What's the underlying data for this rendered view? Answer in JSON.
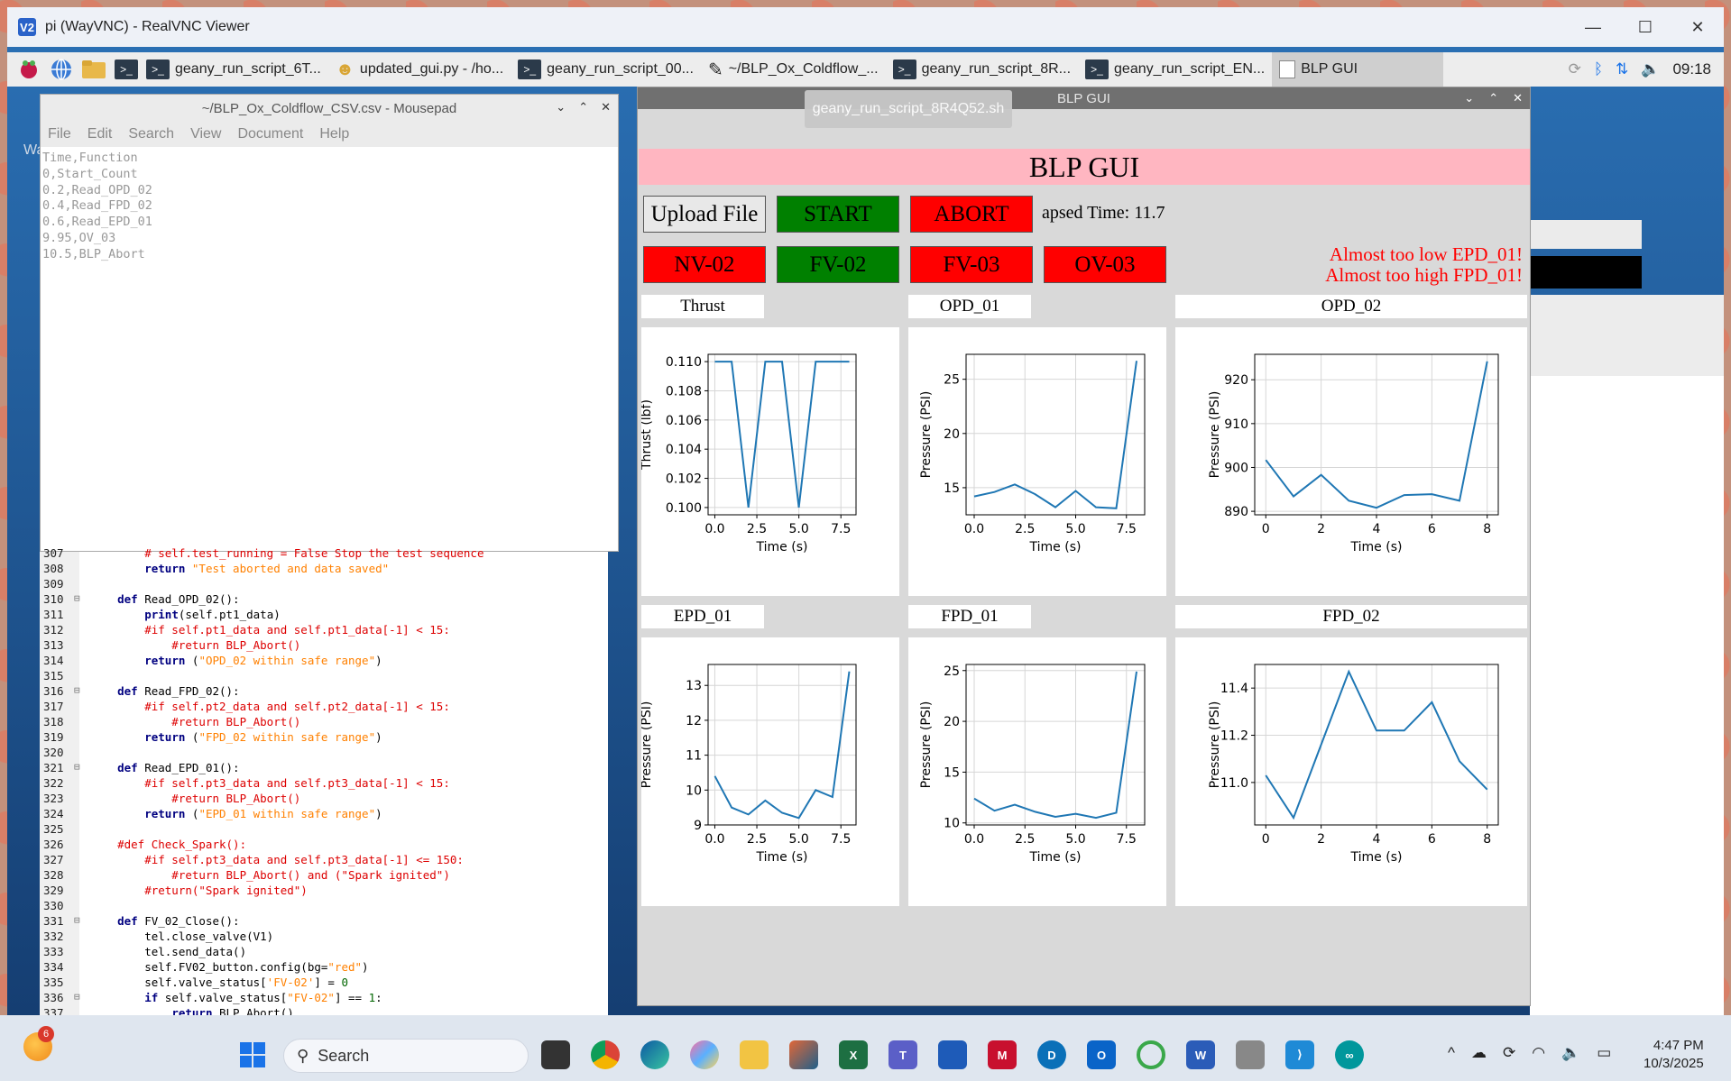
{
  "vnc": {
    "title": "pi (WayVNC) - RealVNC Viewer",
    "logo": "V2",
    "controls": [
      "—",
      "☐",
      "✕"
    ]
  },
  "pi_panel": {
    "tasks": [
      {
        "label": "geany_run_script_6T...",
        "icon": "terminal-icon"
      },
      {
        "label": "updated_gui.py - /ho...",
        "icon": "geany-icon"
      },
      {
        "label": "geany_run_script_00...",
        "icon": "terminal-icon"
      },
      {
        "label": "~/BLP_Ox_Coldflow_...",
        "icon": "mousepad-icon"
      },
      {
        "label": "geany_run_script_8R...",
        "icon": "terminal-icon"
      },
      {
        "label": "geany_run_script_EN...",
        "icon": "terminal-icon"
      },
      {
        "label": "BLP GUI",
        "icon": "window-icon"
      }
    ],
    "time": "09:18"
  },
  "tooltip": "geany_run_script_8R4Q52.sh",
  "side_label": "Wa",
  "mousepad": {
    "title": "~/BLP_Ox_Coldflow_CSV.csv - Mousepad",
    "menu": [
      "File",
      "Edit",
      "Search",
      "View",
      "Document",
      "Help"
    ],
    "content": "Time,Function\n0,Start_Count\n0.2,Read_OPD_02\n0.4,Read_FPD_02\n0.6,Read_EPD_01\n9.95,OV_03\n10.5,BLP_Abort"
  },
  "editor": {
    "lines": [
      {
        "n": "307",
        "text": "        # self.test_running = False Stop the test sequence",
        "cls": "cmt"
      },
      {
        "n": "308",
        "text": "        return \"Test aborted and data saved\"",
        "cls": "mix_return_str"
      },
      {
        "n": "309",
        "text": "",
        "cls": ""
      },
      {
        "n": "310",
        "text": "    def Read_OPD_02():",
        "cls": "def",
        "fold": true
      },
      {
        "n": "311",
        "text": "        print(self.pt1_data)",
        "cls": "print"
      },
      {
        "n": "312",
        "text": "        #if self.pt1_data and self.pt1_data[-1] < 15:",
        "cls": "cmt"
      },
      {
        "n": "313",
        "text": "            #return BLP_Abort()",
        "cls": "cmt"
      },
      {
        "n": "314",
        "text": "        return (\"OPD_02 within safe range\")",
        "cls": "mix_return_str"
      },
      {
        "n": "315",
        "text": "",
        "cls": ""
      },
      {
        "n": "316",
        "text": "    def Read_FPD_02():",
        "cls": "def",
        "fold": true
      },
      {
        "n": "317",
        "text": "        #if self.pt2_data and self.pt2_data[-1] < 15:",
        "cls": "cmt"
      },
      {
        "n": "318",
        "text": "            #return BLP_Abort()",
        "cls": "cmt"
      },
      {
        "n": "319",
        "text": "        return (\"FPD_02 within safe range\")",
        "cls": "mix_return_str"
      },
      {
        "n": "320",
        "text": "",
        "cls": ""
      },
      {
        "n": "321",
        "text": "    def Read_EPD_01():",
        "cls": "def",
        "fold": true
      },
      {
        "n": "322",
        "text": "        #if self.pt3_data and self.pt3_data[-1] < 15:",
        "cls": "cmt"
      },
      {
        "n": "323",
        "text": "            #return BLP_Abort()",
        "cls": "cmt"
      },
      {
        "n": "324",
        "text": "        return (\"EPD_01 within safe range\")",
        "cls": "mix_return_str"
      },
      {
        "n": "325",
        "text": "",
        "cls": ""
      },
      {
        "n": "326",
        "text": "    #def Check_Spark():",
        "cls": "cmt"
      },
      {
        "n": "327",
        "text": "        #if self.pt3_data and self.pt3_data[-1] <= 150:",
        "cls": "cmt"
      },
      {
        "n": "328",
        "text": "            #return BLP_Abort() and (\"Spark ignited\")",
        "cls": "cmt"
      },
      {
        "n": "329",
        "text": "        #return(\"Spark ignited\")",
        "cls": "cmt"
      },
      {
        "n": "330",
        "text": "",
        "cls": ""
      },
      {
        "n": "331",
        "text": "    def FV_02_Close():",
        "cls": "def",
        "fold": true
      },
      {
        "n": "332",
        "text": "        tel.close_valve(V1)",
        "cls": "plain"
      },
      {
        "n": "333",
        "text": "        tel.send_data()",
        "cls": "plain"
      },
      {
        "n": "334",
        "text": "        self.FV02_button.config(bg=\"red\")",
        "cls": "plain"
      },
      {
        "n": "335",
        "text": "        self.valve_status['FV-02'] = 0",
        "cls": "plain"
      },
      {
        "n": "336",
        "text": "        if self.valve_status[\"FV-02\"] == 1:",
        "cls": "if",
        "fold": true
      },
      {
        "n": "337",
        "text": "            return BLP_Abort()",
        "cls": "mix_return"
      }
    ]
  },
  "blp": {
    "window_title": "BLP GUI",
    "banner": "BLP GUI",
    "buttons": {
      "upload": "Upload File",
      "start": "START",
      "abort": "ABORT",
      "nv02": "NV-02",
      "fv02": "FV-02",
      "fv03": "FV-03",
      "ov03": "OV-03"
    },
    "elapsed": "apsed Time: 11.7",
    "warnings": [
      "Almost too low EPD_01!",
      "Almost too high FPD_01!"
    ],
    "colors": {
      "red": "#ff0000",
      "green": "#008000",
      "banner": "#ffb6c1"
    }
  },
  "chart_data": [
    {
      "type": "line",
      "title": "Thrust",
      "xlabel": "Time (s)",
      "ylabel": "Thrust (lbf)",
      "x": [
        0,
        1,
        2,
        3,
        4,
        5,
        6,
        7,
        8
      ],
      "y": [
        0.11,
        0.11,
        0.1,
        0.11,
        0.11,
        0.1,
        0.11,
        0.11,
        0.11
      ],
      "xlim": [
        -0.4,
        8.4
      ],
      "ylim": [
        0.0995,
        0.1105
      ],
      "xticks": [
        0,
        2.5,
        5,
        7.5
      ],
      "xtick_labels": [
        "0.0",
        "2.5",
        "5.0",
        "7.5"
      ],
      "yticks": [
        0.1,
        0.102,
        0.104,
        0.106,
        0.108,
        0.11
      ],
      "ytick_labels": [
        "0.100",
        "0.102",
        "0.104",
        "0.106",
        "0.108",
        "0.110"
      ]
    },
    {
      "type": "line",
      "title": "OPD_01",
      "xlabel": "Time (s)",
      "ylabel": "Pressure (PSI)",
      "x": [
        0,
        1,
        2,
        3,
        4,
        5,
        6,
        7,
        8
      ],
      "y": [
        14.2,
        14.6,
        15.3,
        14.4,
        13.2,
        14.7,
        13.2,
        13.1,
        26.7
      ],
      "xlim": [
        -0.4,
        8.4
      ],
      "ylim": [
        12.5,
        27.3
      ],
      "xticks": [
        0,
        2.5,
        5,
        7.5
      ],
      "xtick_labels": [
        "0.0",
        "2.5",
        "5.0",
        "7.5"
      ],
      "yticks": [
        15,
        20,
        25
      ],
      "ytick_labels": [
        "15",
        "20",
        "25"
      ]
    },
    {
      "type": "line",
      "title": "OPD_02",
      "xlabel": "Time (s)",
      "ylabel": "Pressure (PSI)",
      "x": [
        0,
        1,
        2,
        3,
        4,
        5,
        6,
        7,
        8
      ],
      "y": [
        901.7,
        893.4,
        898.3,
        892.4,
        890.8,
        893.7,
        893.9,
        892.4,
        924.2
      ],
      "xlim": [
        -0.4,
        8.4
      ],
      "ylim": [
        889.2,
        925.8
      ],
      "xticks": [
        0,
        2,
        4,
        6,
        8
      ],
      "xtick_labels": [
        "0",
        "2",
        "4",
        "6",
        "8"
      ],
      "yticks": [
        890,
        900,
        910,
        920
      ],
      "ytick_labels": [
        "890",
        "900",
        "910",
        "920"
      ]
    },
    {
      "type": "line",
      "title": "EPD_01",
      "xlabel": "Time (s)",
      "ylabel": "Pressure (PSI)",
      "x": [
        0,
        1,
        2,
        3,
        4,
        5,
        6,
        7,
        8
      ],
      "y": [
        10.4,
        9.5,
        9.3,
        9.7,
        9.35,
        9.2,
        10.0,
        9.8,
        13.4
      ],
      "xlim": [
        -0.4,
        8.4
      ],
      "ylim": [
        9.0,
        13.6
      ],
      "xticks": [
        0,
        2.5,
        5,
        7.5
      ],
      "xtick_labels": [
        "0.0",
        "2.5",
        "5.0",
        "7.5"
      ],
      "yticks": [
        9,
        10,
        11,
        12,
        13
      ],
      "ytick_labels": [
        "9",
        "10",
        "11",
        "12",
        "13"
      ]
    },
    {
      "type": "line",
      "title": "FPD_01",
      "xlabel": "Time (s)",
      "ylabel": "Pressure (PSI)",
      "x": [
        0,
        1,
        2,
        3,
        4,
        5,
        6,
        7,
        8
      ],
      "y": [
        12.4,
        11.2,
        11.8,
        11.1,
        10.6,
        10.9,
        10.5,
        11.0,
        24.9
      ],
      "xlim": [
        -0.4,
        8.4
      ],
      "ylim": [
        9.8,
        25.6
      ],
      "xticks": [
        0,
        2.5,
        5,
        7.5
      ],
      "xtick_labels": [
        "0.0",
        "2.5",
        "5.0",
        "7.5"
      ],
      "yticks": [
        10,
        15,
        20,
        25
      ],
      "ytick_labels": [
        "10",
        "15",
        "20",
        "25"
      ]
    },
    {
      "type": "line",
      "title": "FPD_02",
      "xlabel": "Time (s)",
      "ylabel": "Pressure (PSI)",
      "x": [
        0,
        1,
        2,
        3,
        4,
        5,
        6,
        7,
        8
      ],
      "y": [
        11.03,
        10.85,
        11.16,
        11.47,
        11.22,
        11.22,
        11.34,
        11.09,
        10.97
      ],
      "xlim": [
        -0.4,
        8.4
      ],
      "ylim": [
        10.82,
        11.5
      ],
      "xticks": [
        0,
        2,
        4,
        6,
        8
      ],
      "xtick_labels": [
        "0",
        "2",
        "4",
        "6",
        "8"
      ],
      "yticks": [
        11.0,
        11.2,
        11.4
      ],
      "ytick_labels": [
        "11.0",
        "11.2",
        "11.4"
      ]
    }
  ],
  "win_taskbar": {
    "search": "Search",
    "badge": "6",
    "time": "4:47 PM",
    "date": "10/3/2025",
    "tray_chevron": "^"
  }
}
